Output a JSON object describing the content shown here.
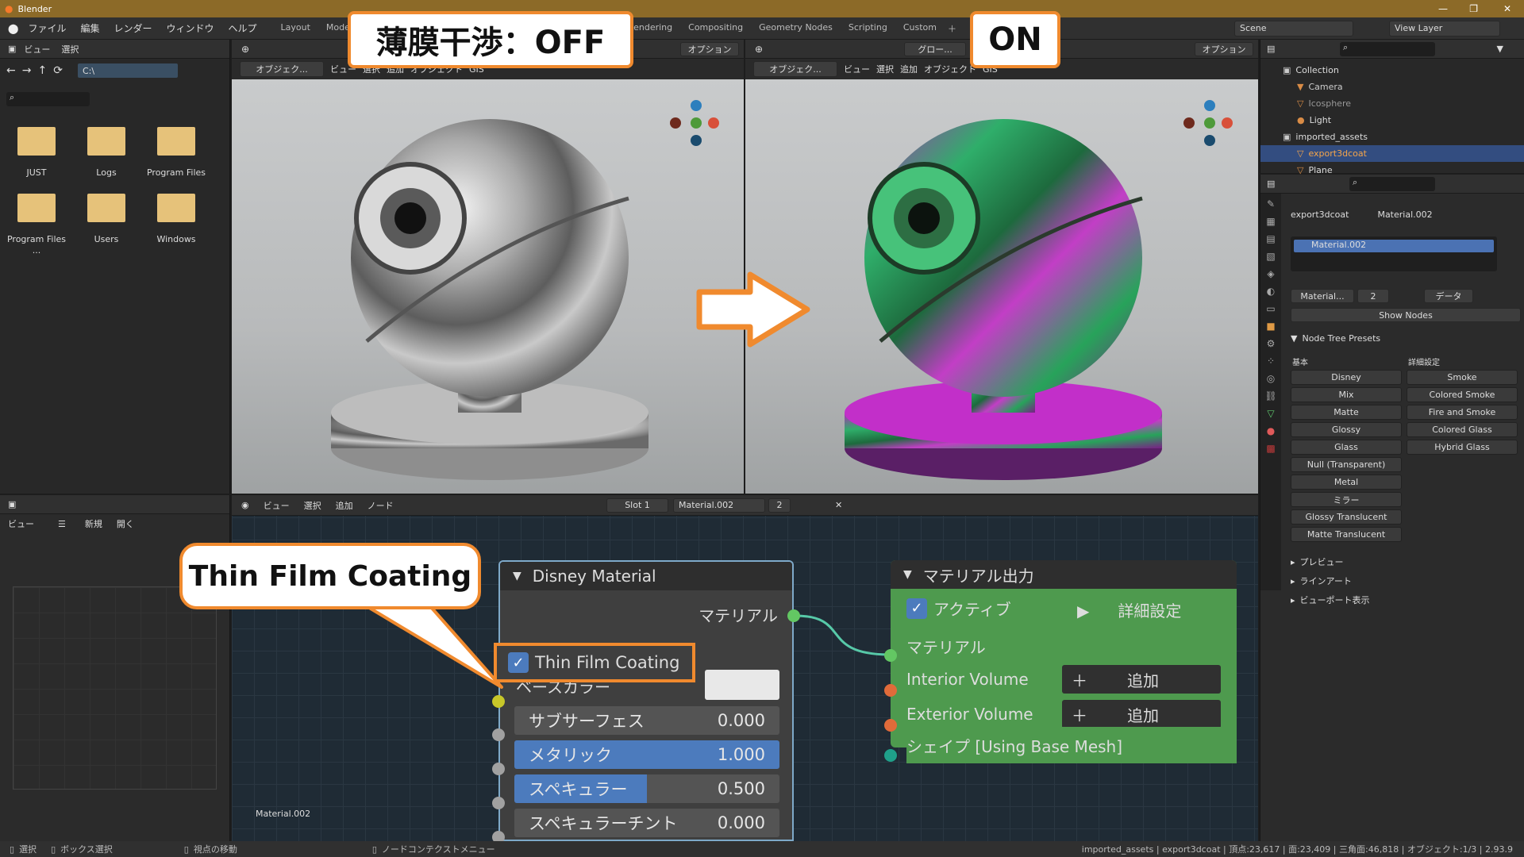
{
  "window": {
    "title": "Blender"
  },
  "menubar": {
    "file": "ファイル",
    "edit": "編集",
    "render": "レンダー",
    "window": "ウィンドウ",
    "help": "ヘルプ"
  },
  "workspace_tabs": [
    "Layout",
    "Modeling",
    "Rendering",
    "Compositing",
    "Geometry Nodes",
    "Scripting",
    "Custom"
  ],
  "scene": {
    "name": "Scene",
    "view_layer": "View Layer"
  },
  "callouts": {
    "off": "薄膜干渉：OFF",
    "on": "ON",
    "thin_film": "Thin Film Coating"
  },
  "file_browser": {
    "view": "ビュー",
    "select": "選択",
    "path": "C:\\",
    "folders": [
      "JUST",
      "Logs",
      "Program Files",
      "Program Files ...",
      "Users",
      "Windows"
    ]
  },
  "viewport": {
    "object_mode": "オブジェク...",
    "view": "ビュー",
    "select": "選択",
    "add": "追加",
    "object": "オブジェクト",
    "gis": "GIS",
    "options": "オプション",
    "global": "グロー..."
  },
  "image_editor": {
    "view": "ビュー",
    "new": "新規",
    "open": "開く"
  },
  "node_editor": {
    "view": "ビュー",
    "select": "選択",
    "add": "追加",
    "node": "ノード",
    "slot": "Slot 1",
    "material": "Material.002",
    "users": "2",
    "label": "Material.002"
  },
  "disney_node": {
    "title": "Disney Material",
    "output": "マテリアル",
    "thin_film": "Thin Film Coating",
    "base_color": "ベースカラー",
    "fields": [
      {
        "label": "サブサーフェス",
        "value": "0.000"
      },
      {
        "label": "メタリック",
        "value": "1.000"
      },
      {
        "label": "スペキュラー",
        "value": "0.500"
      },
      {
        "label": "スペキュラーチント",
        "value": "0.000"
      }
    ]
  },
  "output_node": {
    "title": "マテリアル出力",
    "active": "アクティブ",
    "advanced": "詳細設定",
    "material": "マテリアル",
    "interior": "Interior Volume",
    "exterior": "Exterior Volume",
    "shape": "シェイプ [Using Base Mesh]",
    "add": "追加"
  },
  "outliner": {
    "items": [
      {
        "name": "Collection",
        "level": 0
      },
      {
        "name": "Camera",
        "level": 1
      },
      {
        "name": "Icosphere",
        "level": 1
      },
      {
        "name": "Light",
        "level": 1
      },
      {
        "name": "imported_assets",
        "level": 0
      },
      {
        "name": "export3dcoat",
        "level": 1
      },
      {
        "name": "Plane",
        "level": 1
      }
    ]
  },
  "properties": {
    "object": "export3dcoat",
    "material": "Material.002",
    "slot_item": "Material.002",
    "mat_short": "Material...",
    "users": "2",
    "data": "データ",
    "show_nodes": "Show Nodes",
    "presets_title": "Node Tree Presets",
    "basic": "基本",
    "advanced": "詳細設定",
    "basic_presets": [
      "Disney",
      "Mix",
      "Matte",
      "Glossy",
      "Glass",
      "Null (Transparent)",
      "Metal",
      "ミラー",
      "Glossy Translucent",
      "Matte Translucent"
    ],
    "advanced_presets": [
      "Smoke",
      "Colored Smoke",
      "Fire and Smoke",
      "Colored Glass",
      "Hybrid Glass"
    ],
    "sections": [
      "プレビュー",
      "ラインアート",
      "ビューポート表示"
    ]
  },
  "statusbar": {
    "select": "選択",
    "box_select": "ボックス選択",
    "move_view": "視点の移動",
    "context_menu": "ノードコンテクストメニュー",
    "stats": "imported_assets | export3dcoat | 頂点:23,617 | 面:23,409 | 三角面:46,818 | オブジェクト:1/3 | 2.93.9"
  }
}
